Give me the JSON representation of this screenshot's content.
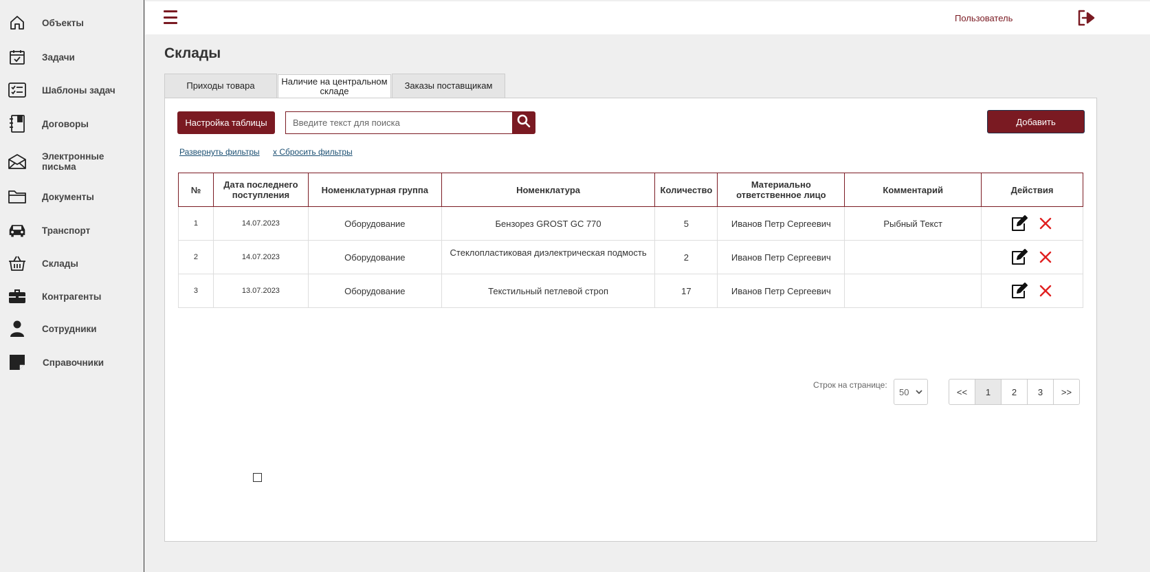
{
  "sidebar": {
    "items": [
      {
        "label": "Объекты",
        "icon": "home-icon"
      },
      {
        "label": "Задачи",
        "icon": "calendar-check-icon"
      },
      {
        "label": "Шаблоны задач",
        "icon": "checklist-icon"
      },
      {
        "label": "Договоры",
        "icon": "notebook-icon"
      },
      {
        "label": "Электронные письма",
        "icon": "envelope-icon"
      },
      {
        "label": "Документы",
        "icon": "folder-icon"
      },
      {
        "label": "Транспорт",
        "icon": "car-icon"
      },
      {
        "label": "Склады",
        "icon": "basket-icon"
      },
      {
        "label": "Контрагенты",
        "icon": "briefcase-icon"
      },
      {
        "label": "Сотрудники",
        "icon": "person-icon"
      },
      {
        "label": "Справочники",
        "icon": "sticky-note-icon"
      }
    ]
  },
  "header": {
    "user_label": "Пользователь"
  },
  "page": {
    "title": "Склады"
  },
  "tabs": [
    {
      "label": "Приходы товара",
      "active": false
    },
    {
      "label": "Наличие на центральном складе",
      "active": true
    },
    {
      "label": "Заказы поставщикам",
      "active": false
    }
  ],
  "toolbar": {
    "table_settings_label": "Настройка таблицы",
    "search_placeholder": "Введите текст для поиска",
    "add_label": "Добавить",
    "expand_filters": "Развернуть фильтры",
    "reset_filters": "x Сбросить фильтры"
  },
  "table": {
    "columns": [
      "№",
      "Дата последнего поступления",
      "Номенклатурная группа",
      "Номенклатура",
      "Количество",
      "Материально ответственное лицо",
      "Комментарий",
      "Действия"
    ],
    "rows": [
      [
        "1",
        "14.07.2023",
        "Оборудование",
        "Бензорез GROST GC 770",
        "5",
        "Иванов Петр Сергеевич",
        "Рыбный Текст"
      ],
      [
        "2",
        "14.07.2023",
        "Оборудование",
        "Стеклопластиковая диэлектрическая подмость",
        "2",
        "Иванов Петр Сергеевич",
        ""
      ],
      [
        "3",
        "13.07.2023",
        "Оборудование",
        "Текстильный петлевой строп",
        "17",
        "Иванов Петр Сергеевич",
        ""
      ]
    ]
  },
  "pagination": {
    "rows_label": "Строк на странице:",
    "rows_value": "50",
    "pages": [
      "<<",
      "1",
      "2",
      "3",
      ">>"
    ],
    "current": "1"
  },
  "colors": {
    "accent": "#7a1a22",
    "link": "#1b4f72",
    "delete": "#e02020"
  }
}
